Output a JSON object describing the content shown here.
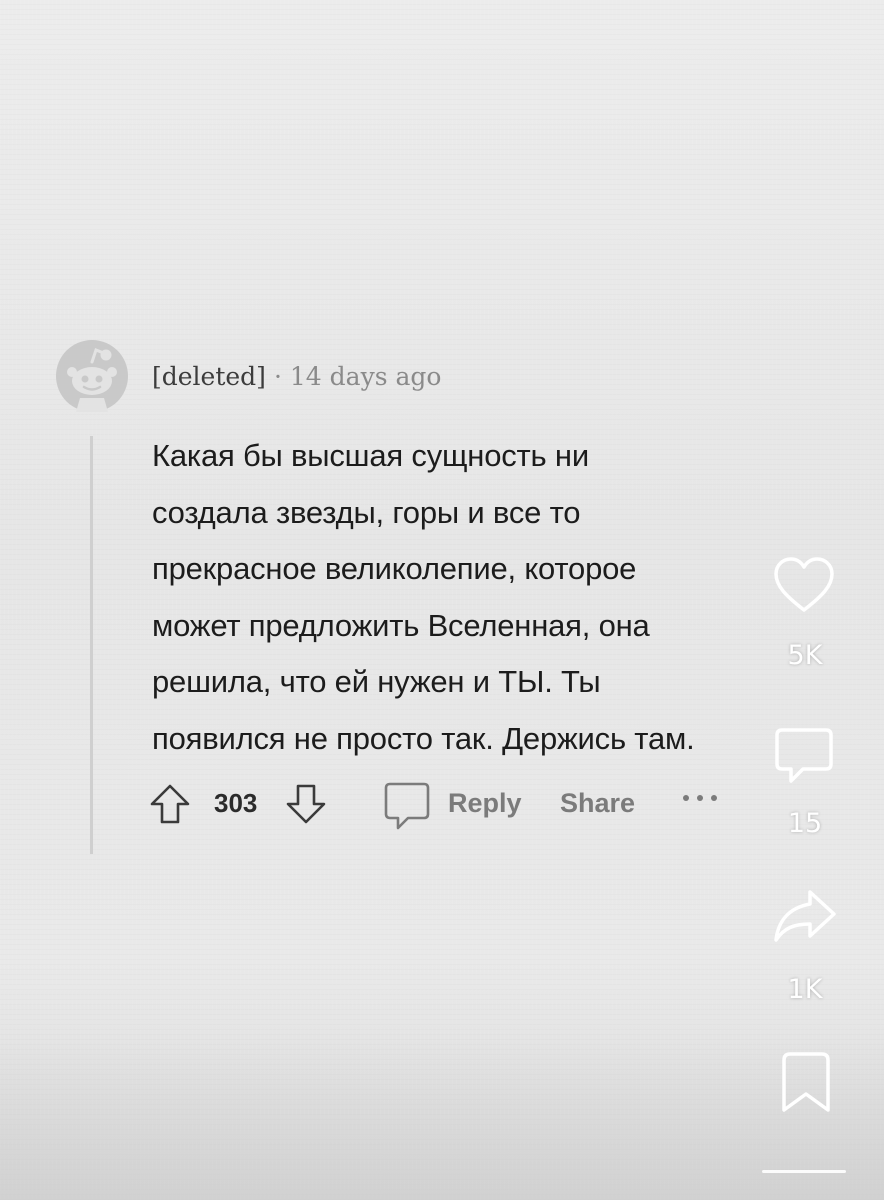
{
  "comment": {
    "username": "[deleted]",
    "separator": "·",
    "time": "14 days ago",
    "body_lines": [
      "Какая бы высшая сущность ни",
      "создала звезды, горы и все то",
      "прекрасное великолепие, которое",
      "может предложить Вселенная, она",
      "решила, что ей нужен и ТЫ. Ты",
      "появился не просто так. Держись там."
    ],
    "score": "303",
    "reply_label": "Reply",
    "share_label": "Share"
  },
  "rail": {
    "likes": "5K",
    "comments": "15",
    "shares": "1K"
  },
  "icons": {
    "avatar": "reddit-default-avatar-icon",
    "upvote": "arrow-up-icon",
    "downvote": "arrow-down-icon",
    "reply": "comment-bubble-icon",
    "more": "more-dots-icon",
    "like": "heart-icon",
    "comment": "comment-icon",
    "share": "share-arrow-icon",
    "save": "bookmark-icon"
  },
  "colors": {
    "background": "#e8e8e8",
    "text": "#1c1c1c",
    "muted": "#7b7b7b",
    "overlay": "#ffffff"
  }
}
